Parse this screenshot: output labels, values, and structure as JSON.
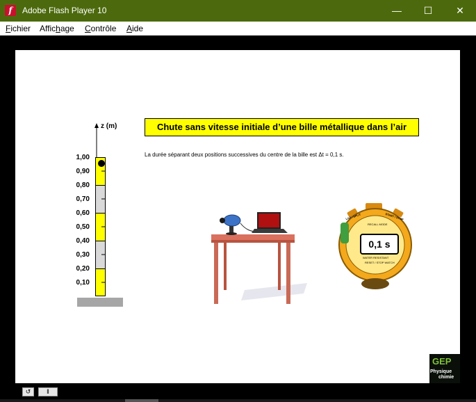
{
  "window": {
    "title": "Adobe Flash Player 10",
    "minimize_glyph": "—",
    "maximize_glyph": "☐",
    "close_glyph": "✕"
  },
  "menu": {
    "items": [
      {
        "accel": "F",
        "rest": "ichier"
      },
      {
        "prefix": "Affic",
        "accel": "h",
        "rest": "age"
      },
      {
        "accel": "C",
        "rest": "ontrôle"
      },
      {
        "accel": "A",
        "rest": "ide"
      }
    ]
  },
  "ruler": {
    "axis_label": "z (m)",
    "ticks": [
      "1,00",
      "0,90",
      "0,80",
      "0,70",
      "0,60",
      "0,50",
      "0,40",
      "0,30",
      "0,20",
      "0,10"
    ],
    "colors": {
      "yellow": "#ffff00",
      "gray": "#d9d9d9"
    }
  },
  "headline": "Chute sans vitesse initiale d’une bille métallique dans l’air",
  "description": "La durée séparant deux positions successives du centre de la bille est Δt = 0,1 s.",
  "stopwatch": {
    "display": "0,1 s",
    "top_label": "LAP / SPLIT",
    "top_label_right": "START / STOP",
    "recall_label": "RECALL   MODE",
    "water_label": "WATER RESISTANT",
    "bottom_label": "RESET / STOP WATCH"
  },
  "logo": {
    "big": "GEP",
    "line1": "Physique",
    "line2": "chimie"
  },
  "controls": {
    "rewind_glyph": "↺",
    "pause_glyph": "‖"
  },
  "colors": {
    "titlebar": "#4c6a0d",
    "headline_bg": "#ffff00",
    "stopwatch_body": "#f4a81c",
    "table": "#d9715e"
  }
}
